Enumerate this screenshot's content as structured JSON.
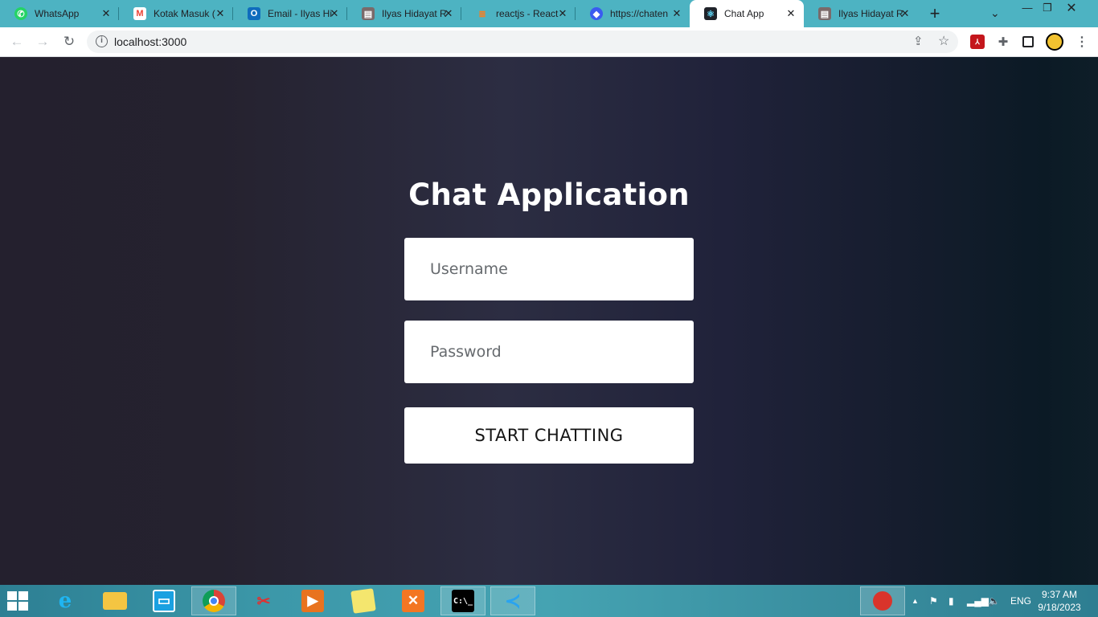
{
  "browser": {
    "tabs": [
      {
        "label": "WhatsApp",
        "icon": "whatsapp-icon",
        "color": "#25d366"
      },
      {
        "label": "Kotak Masuk (",
        "icon": "gmail-icon",
        "color": "#ea4335"
      },
      {
        "label": "Email - Ilyas Hi",
        "icon": "outlook-icon",
        "color": "#0f6cbd"
      },
      {
        "label": "Ilyas Hidayat R",
        "icon": "page-icon",
        "color": "#7a6a6a"
      },
      {
        "label": "reactjs - React",
        "icon": "stackoverflow-icon",
        "color": "#f48024"
      },
      {
        "label": "https://chaten",
        "icon": "chatengine-icon",
        "color": "#3a5bf0"
      },
      {
        "label": "Chat App",
        "icon": "react-icon",
        "color": "#20232a"
      },
      {
        "label": "Ilyas Hidayat R",
        "icon": "page-icon",
        "color": "#7a6a6a"
      }
    ],
    "active_tab_index": 6,
    "url": "localhost:3000"
  },
  "page": {
    "title": "Chat Application",
    "username_placeholder": "Username",
    "password_placeholder": "Password",
    "submit_label": "START CHATTING"
  },
  "taskbar": {
    "apps": [
      "internet-explorer-icon",
      "file-explorer-icon",
      "store-icon",
      "chrome-icon",
      "snipping-tool-icon",
      "media-player-icon",
      "sticky-notes-icon",
      "xampp-icon",
      "cmd-icon",
      "vscode-icon"
    ],
    "language": "ENG",
    "time": "9:37 AM",
    "date": "9/18/2023"
  }
}
